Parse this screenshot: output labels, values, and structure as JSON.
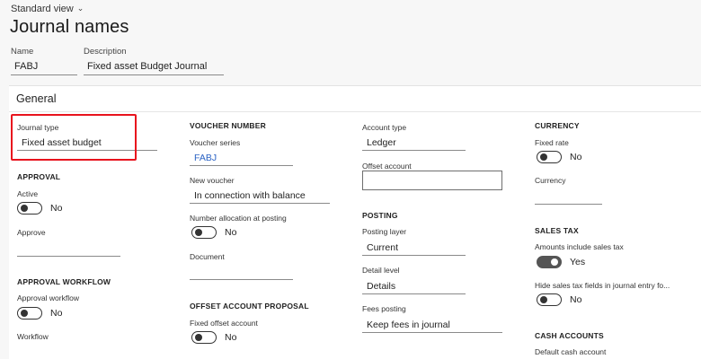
{
  "header": {
    "view_label": "Standard view",
    "page_title": "Journal names",
    "name_label": "Name",
    "name_value": "FABJ",
    "description_label": "Description",
    "description_value": "Fixed asset Budget Journal"
  },
  "card": {
    "title": "General"
  },
  "col1": {
    "journal_type_label": "Journal type",
    "journal_type_value": "Fixed asset budget",
    "approval_header": "APPROVAL",
    "active_label": "Active",
    "active_state": "No",
    "approve_label": "Approve",
    "approval_workflow_header": "APPROVAL WORKFLOW",
    "approval_workflow_label": "Approval workflow",
    "approval_workflow_state": "No",
    "workflow_label": "Workflow"
  },
  "col2": {
    "voucher_header": "VOUCHER NUMBER",
    "voucher_series_label": "Voucher series",
    "voucher_series_value": "FABJ",
    "new_voucher_label": "New voucher",
    "new_voucher_value": "In connection with balance",
    "number_alloc_label": "Number allocation at posting",
    "number_alloc_state": "No",
    "document_label": "Document",
    "offset_proposal_header": "OFFSET ACCOUNT PROPOSAL",
    "fixed_offset_label": "Fixed offset account",
    "fixed_offset_state": "No"
  },
  "col3": {
    "account_type_label": "Account type",
    "account_type_value": "Ledger",
    "offset_account_label": "Offset account",
    "posting_header": "POSTING",
    "posting_layer_label": "Posting layer",
    "posting_layer_value": "Current",
    "detail_level_label": "Detail level",
    "detail_level_value": "Details",
    "fees_posting_label": "Fees posting",
    "fees_posting_value": "Keep fees in journal"
  },
  "col4": {
    "currency_header": "CURRENCY",
    "fixed_rate_label": "Fixed rate",
    "fixed_rate_state": "No",
    "currency_label": "Currency",
    "sales_tax_header": "SALES TAX",
    "amounts_incl_label": "Amounts include sales tax",
    "amounts_incl_state": "Yes",
    "hide_fields_label": "Hide sales tax fields in journal entry fo...",
    "hide_fields_state": "No",
    "cash_accounts_header": "CASH ACCOUNTS",
    "default_cash_label": "Default cash account"
  },
  "colors": {
    "highlight": "#e8131d",
    "link": "#2b63c4",
    "toggle_on": "#555555"
  }
}
